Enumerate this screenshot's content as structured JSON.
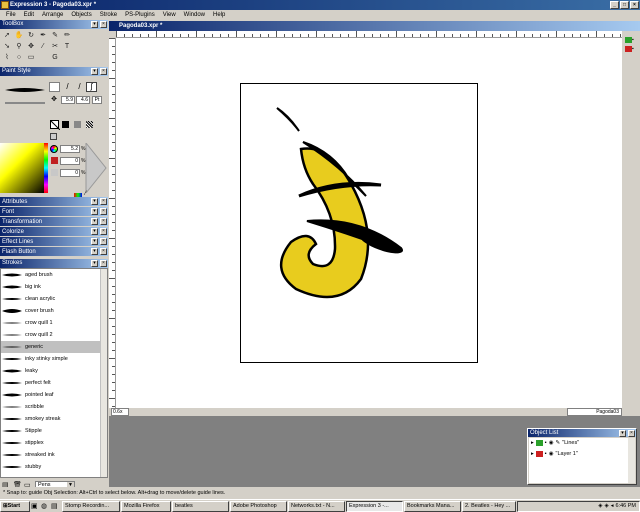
{
  "window": {
    "title": "Expression 3 - Pagoda03.xpr *"
  },
  "menu": [
    "File",
    "Edit",
    "Arrange",
    "Objects",
    "Stroke",
    "PS-Plugins",
    "View",
    "Window",
    "Help"
  ],
  "toolbox": {
    "title": "ToolBox"
  },
  "paint_style": {
    "title": "Paint Style",
    "width_value": "5.9",
    "size_value": "4.6",
    "unit": "Pt",
    "fill_value": "5.2",
    "opacity_value": "0",
    "third_value": "0",
    "percent": "%"
  },
  "panels": [
    "Attributes",
    "Font",
    "Transformation",
    "Colorize",
    "Effect Lines",
    "Flash Button"
  ],
  "strokes": {
    "title": "Strokes",
    "items": [
      "aged brush",
      "big ink",
      "clean acrylic",
      "cover brush",
      "crow quill 1",
      "crow quill 2",
      "generic",
      "inky stinky simple",
      "leaky",
      "perfect felt",
      "pointed leaf",
      "scribble",
      "smokey streak",
      "Stipple",
      "stipplex",
      "streaked ink",
      "stubby"
    ],
    "selected": "generic",
    "category": "Pens"
  },
  "document": {
    "title": "Pagoda03.xpr *",
    "zoom": "0.6x",
    "name_field": "Pagoda03"
  },
  "object_list": {
    "title": "Object List",
    "layers": [
      "\"Lines\"",
      "\"Layer 1\""
    ]
  },
  "status": {
    "text": "* Snap to: guide    Obj Selection: Alt+Ctrl to select below. Alt+drag to move/delete guide lines."
  },
  "taskbar": {
    "start": "Start",
    "items": [
      "Stomp Recordin...",
      "Mozilla Firefox",
      "beatles",
      "Adobe Photoshop",
      "Networks.txt - N...",
      "Expression 3 -...",
      "Bookmarks Mana...",
      "2. Beatles - Hey ..."
    ],
    "active": "Expression 3 -...",
    "clock": "6:46 PM"
  },
  "colors": {
    "fill_yellow": "#e8cc1e",
    "layer_lines": "#2aa02a",
    "layer1": "#cc2020"
  }
}
